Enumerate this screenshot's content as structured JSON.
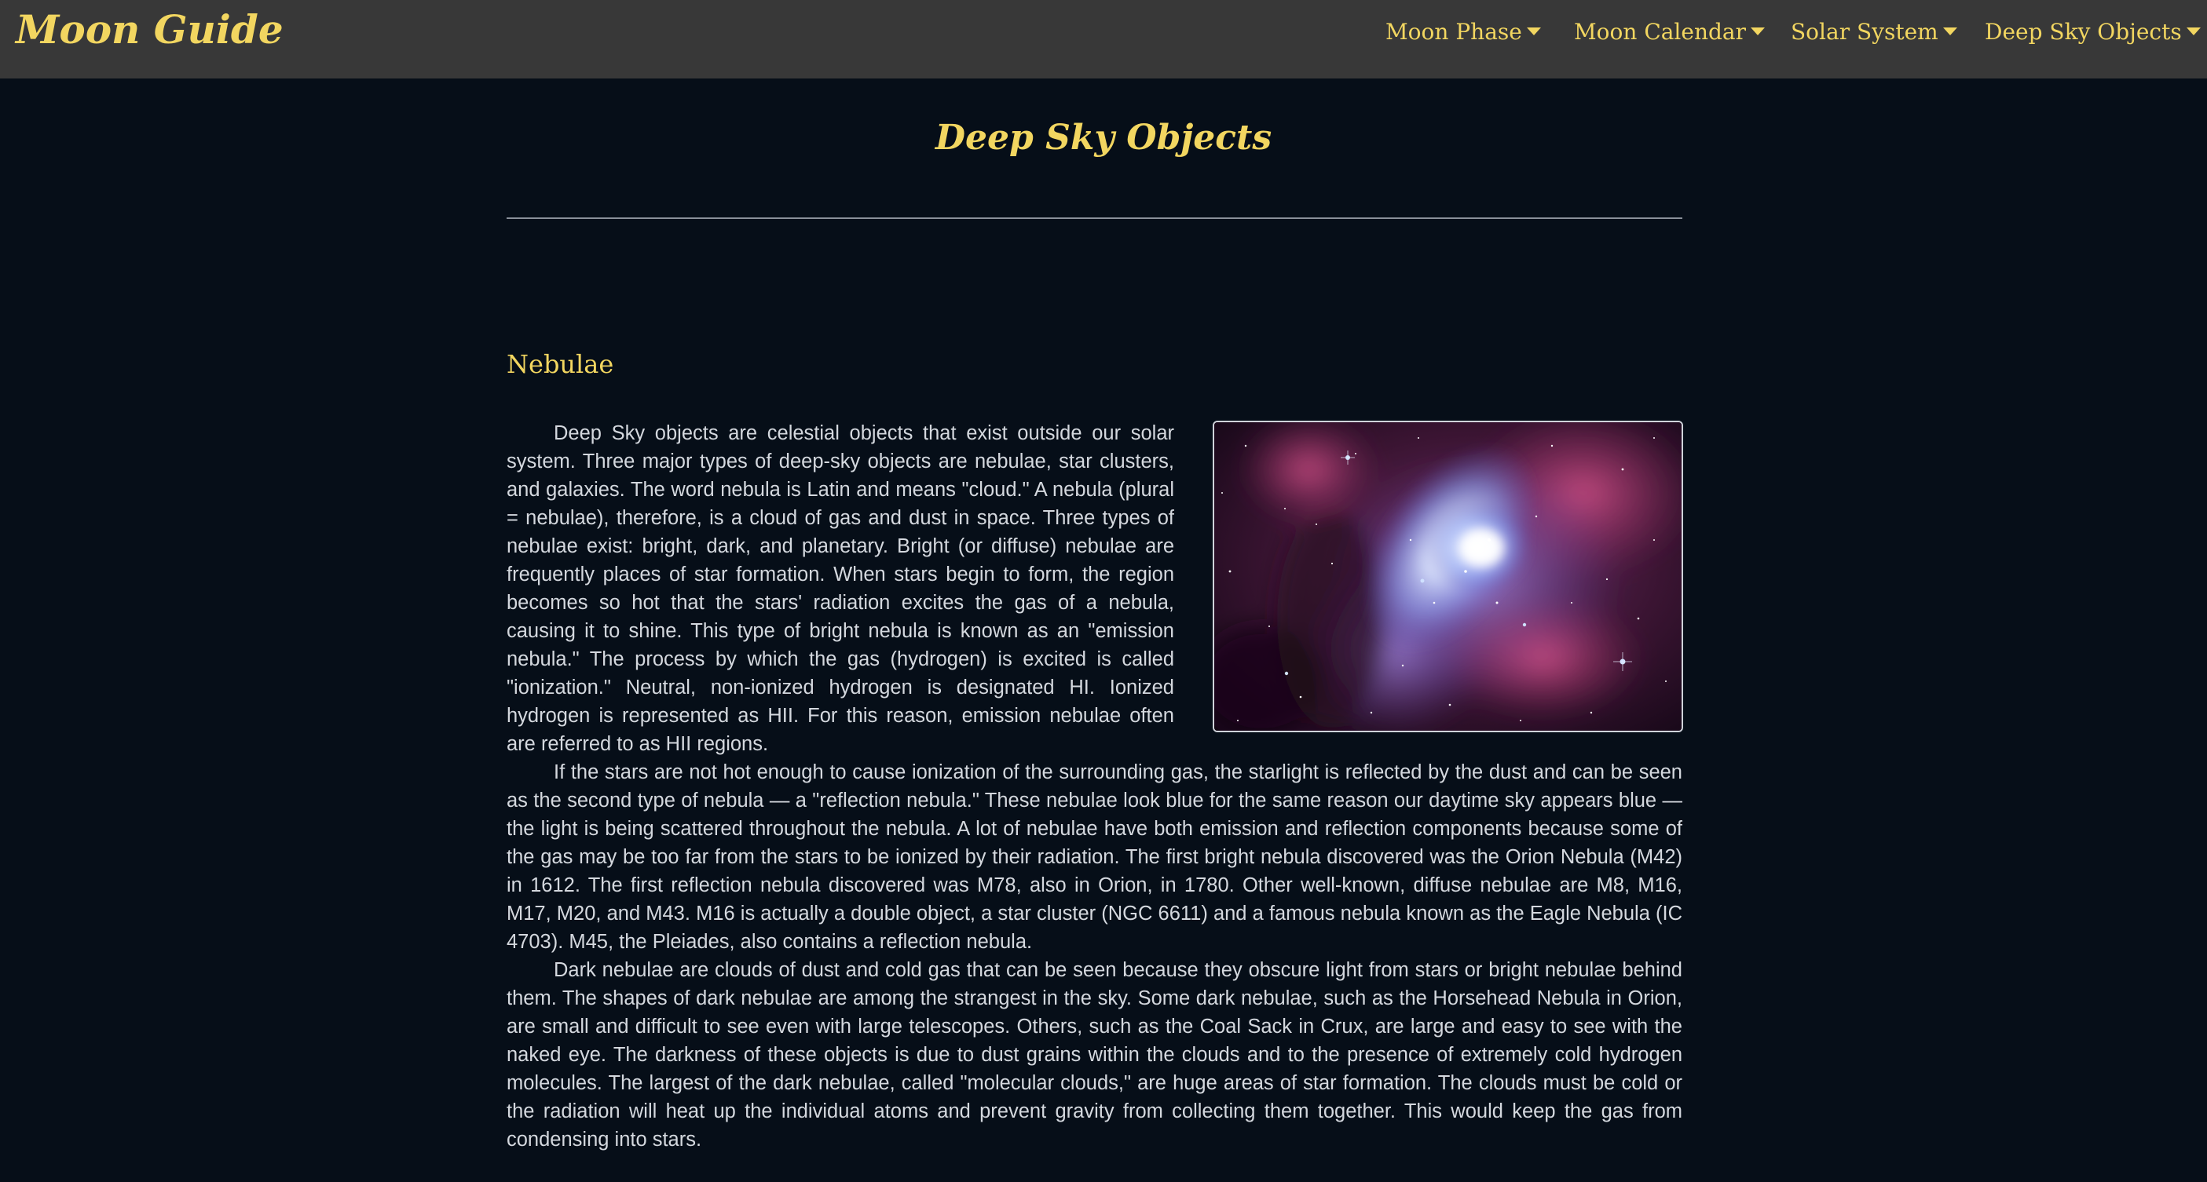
{
  "brand": "Moon Guide",
  "nav": {
    "items": [
      {
        "label": "Moon Phase"
      },
      {
        "label": "Moon Calendar"
      },
      {
        "label": "Solar System"
      },
      {
        "label": "Deep Sky Objects"
      }
    ]
  },
  "page": {
    "title": "Deep Sky Objects"
  },
  "section": {
    "heading": "Nebulae",
    "image_subject": "Orion Nebula photograph",
    "paragraphs": [
      "Deep Sky objects are celestial objects that exist outside our solar system. Three major types of deep-sky objects are nebulae, star clusters, and galaxies. The word nebula is Latin and means \"cloud.\" A nebula (plural = nebulae), therefore, is a cloud of gas and dust in space. Three types of nebulae exist: bright, dark, and planetary. Bright (or diffuse) nebulae are frequently places of star formation. When stars begin to form, the region becomes so hot that the stars' radiation excites the gas of a nebula, causing it to shine. This type of bright nebula is known as an \"emission nebula.\" The process by which the gas (hydrogen) is excited is called \"ionization.\" Neutral, non-ionized hydrogen is designated HI. Ionized hydrogen is represented as HII. For this reason, emission nebulae often are referred to as HII regions.",
      "If the stars are not hot enough to cause ionization of the surrounding gas, the starlight is reflected by the dust and can be seen as the second type of nebula — a \"reflection nebula.\" These nebulae look blue for the same reason our daytime sky appears blue — the light is being scattered throughout the nebula. A lot of nebulae have both emission and reflection components because some of the gas may be too far from the stars to be ionized by their radiation. The first bright nebula discovered was the Orion Nebula (M42) in 1612. The first reflection nebula discovered was M78, also in Orion, in 1780. Other well-known, diffuse nebulae are M8, M16, M17, M20, and M43. M16 is actually a double object, a star cluster (NGC 6611) and a famous nebula known as the Eagle Nebula (IC 4703). M45, the Pleiades, also contains a reflection nebula.",
      "Dark nebulae are clouds of dust and cold gas that can be seen because they obscure light from stars or bright nebulae behind them. The shapes of dark nebulae are among the strangest in the sky. Some dark nebulae, such as the Horsehead Nebula in Orion, are small and difficult to see even with large telescopes. Others, such as the Coal Sack in Crux, are large and easy to see with the naked eye. The darkness of these objects is due to dust grains within the clouds and to the presence of extremely cold hydrogen molecules. The largest of the dark nebulae, called \"molecular clouds,\" are huge areas of star formation. The clouds must be cold or the radiation will heat up the individual atoms and prevent gravity from collecting them together. This would keep the gas from condensing into stars."
    ]
  },
  "colors": {
    "background": "#060e18",
    "navbar": "#383838",
    "accent": "#f2d660",
    "text": "#d4d8de",
    "rule": "#8a9099"
  }
}
